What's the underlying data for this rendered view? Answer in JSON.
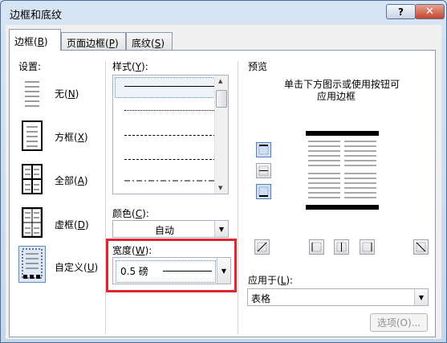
{
  "window": {
    "title": "边框和底纹",
    "help_label": "?",
    "close_label": "✕"
  },
  "tabs": [
    {
      "text": "边框(",
      "key": "B",
      "end": ")"
    },
    {
      "text": "页面边框(",
      "key": "P",
      "end": ")"
    },
    {
      "text": "底纹(",
      "key": "S",
      "end": ")"
    }
  ],
  "settings": {
    "heading": "设置:",
    "items": [
      {
        "text": "无(",
        "key": "N",
        "end": ")",
        "icon": "no-border-icon"
      },
      {
        "text": "方框(",
        "key": "X",
        "end": ")",
        "icon": "box-border-icon"
      },
      {
        "text": "全部(",
        "key": "A",
        "end": ")",
        "icon": "all-borders-icon"
      },
      {
        "text": "虚框(",
        "key": "D",
        "end": ")",
        "icon": "grid-border-icon"
      },
      {
        "text": "自定义(",
        "key": "U",
        "end": ")",
        "icon": "custom-border-icon"
      }
    ],
    "selected": 4
  },
  "style": {
    "label": "样式(",
    "key": "Y",
    "end": "):",
    "options": [
      "solid",
      "dotted",
      "dashed-small",
      "dashed",
      "dash-dot"
    ],
    "selected": 0
  },
  "color": {
    "label": "颜色(",
    "key": "C",
    "end": "):",
    "value": "自动"
  },
  "width": {
    "label": "宽度(",
    "key": "W",
    "end": "):",
    "value": "0.5 磅"
  },
  "preview": {
    "heading": "预览",
    "hint_line1": "单击下方图示或使用按钮可",
    "hint_line2": "应用边框"
  },
  "apply_to": {
    "label": "应用于(",
    "key": "L",
    "end": "):",
    "value": "表格"
  },
  "options_button": "选项(O)...",
  "colors": {
    "highlight": "#e0262e",
    "selection": "#dce8f7",
    "accent": "#5d8ac5"
  }
}
